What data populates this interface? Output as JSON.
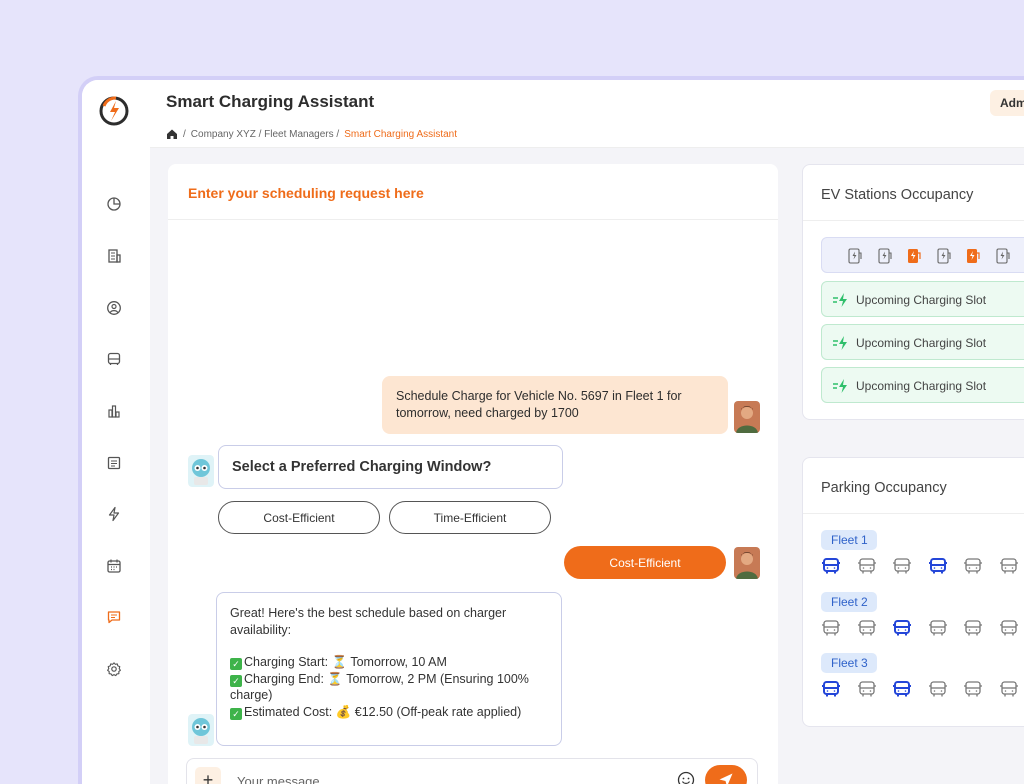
{
  "app": {
    "title": "Smart Charging Assistant",
    "admin_label": "Admin"
  },
  "breadcrumb": {
    "sep": "/",
    "path": "Company XYZ / Fleet Managers /",
    "current": "Smart Charging Assistant"
  },
  "sidebar": {
    "icons": [
      "dashboard-pie-icon",
      "building-icon",
      "user-circle-icon",
      "bus-icon",
      "bar-chart-icon",
      "document-icon",
      "lightning-icon",
      "calendar-icon",
      "chat-icon",
      "settings-icon"
    ],
    "active": "chat-icon"
  },
  "chat": {
    "header": "Enter your scheduling request here",
    "user_message_1": "Schedule  Charge for Vehicle No. 5697 in Fleet 1 for tomorrow, need charged by 1700",
    "bot_question": "Select a Preferred Charging Window?",
    "options": [
      "Cost-Efficient",
      "Time-Efficient"
    ],
    "user_choice": "Cost-Efficient",
    "bot_answer": {
      "intro": "Great! Here's the best schedule based on charger availability:",
      "lines": [
        "Charging Start: ⏳ Tomorrow, 10 AM",
        "Charging End: ⏳ Tomorrow, 2 PM (Ensuring 100% charge)",
        "Estimated Cost: 💰 €12.50 (Off-peak rate applied)"
      ]
    },
    "input_placeholder": "Your message"
  },
  "ev_stations": {
    "title": "EV Stations Occupancy",
    "stations": [
      "free",
      "free",
      "occupied",
      "free",
      "occupied",
      "free"
    ],
    "slots": [
      "Upcoming Charging Slot",
      "Upcoming Charging Slot",
      "Upcoming Charging Slot"
    ]
  },
  "parking": {
    "title": "Parking Occupancy",
    "fleets": [
      {
        "name": "Fleet 1",
        "buses": [
          true,
          false,
          false,
          true,
          false,
          false
        ]
      },
      {
        "name": "Fleet 2",
        "buses": [
          false,
          false,
          true,
          false,
          false,
          false
        ]
      },
      {
        "name": "Fleet 3",
        "buses": [
          true,
          false,
          true,
          false,
          false,
          false
        ]
      }
    ]
  },
  "colors": {
    "accent": "#ef6c1a",
    "occupied_bus": "#2446d8",
    "slot_green": "#2fbf6b"
  }
}
